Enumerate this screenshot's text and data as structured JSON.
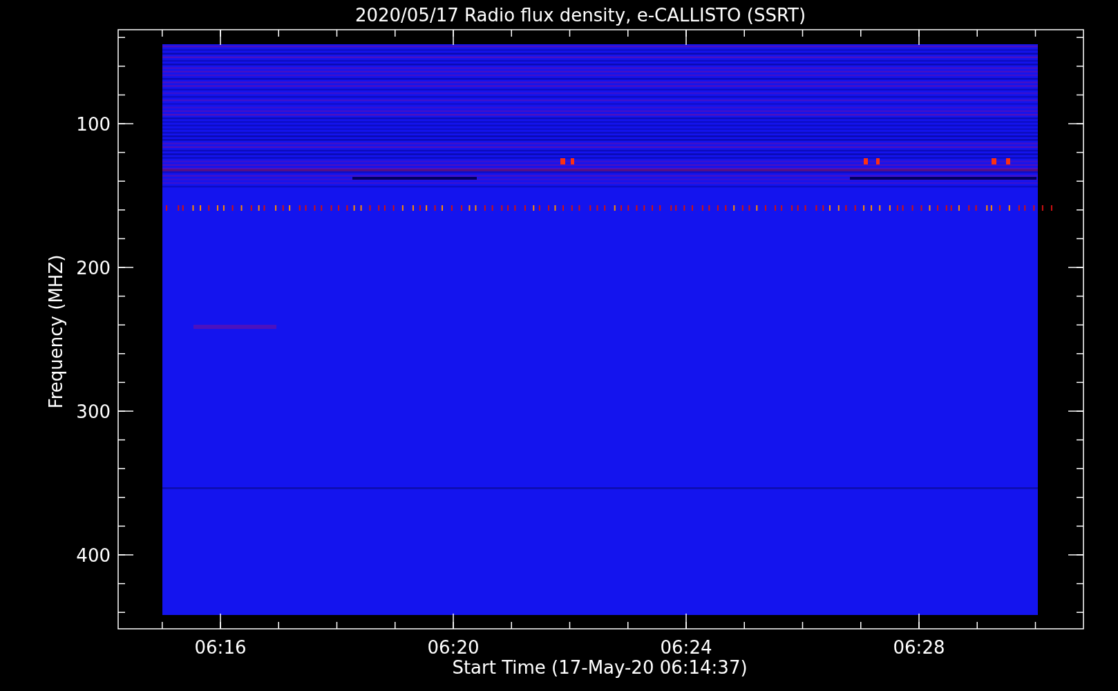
{
  "title": "2020/05/17  Radio flux density, e-CALLISTO (SSRT)",
  "x_axis": {
    "label": "Start Time (17-May-20 06:14:37)",
    "ticks": [
      "06:16",
      "06:20",
      "06:24",
      "06:28"
    ]
  },
  "y_axis": {
    "label": "Frequency (MHZ)",
    "ticks": [
      "100",
      "200",
      "300",
      "400"
    ]
  }
}
